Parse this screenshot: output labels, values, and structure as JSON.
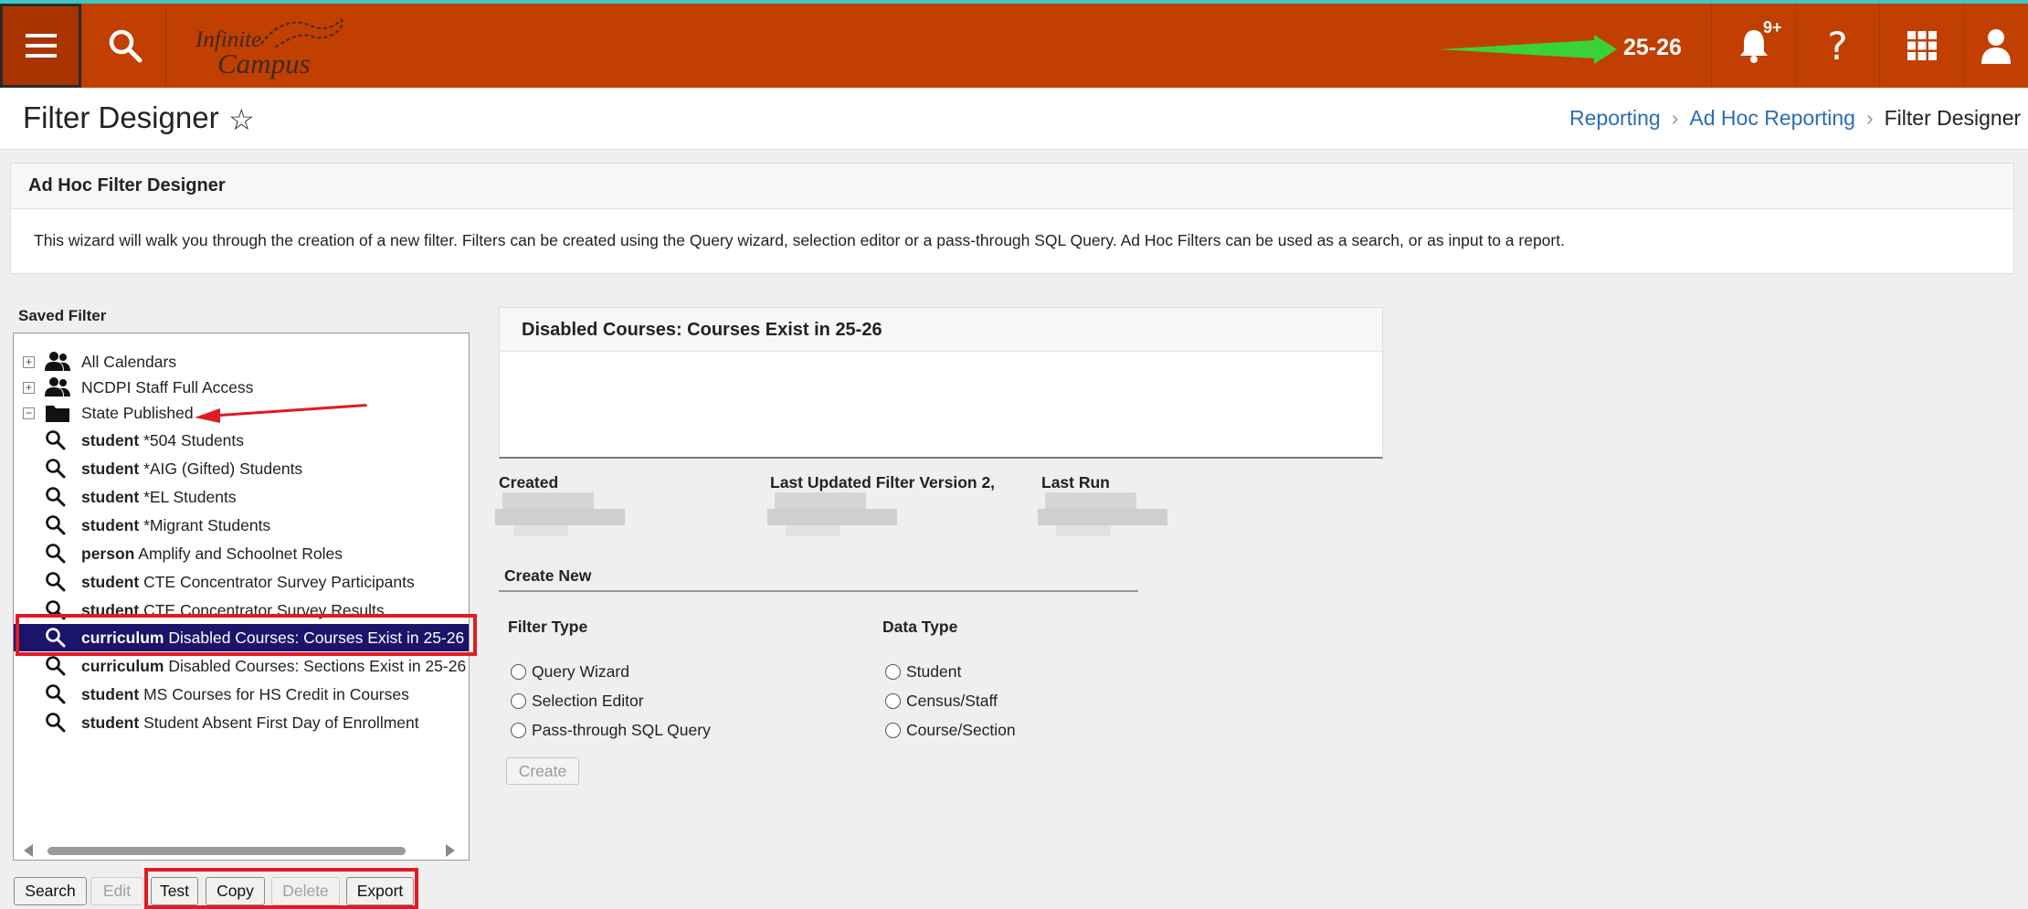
{
  "header": {
    "logo_line1": "Infinite",
    "logo_line2": "Campus",
    "school_year": "25-26",
    "notification_badge": "9+"
  },
  "title": {
    "page_title": "Filter Designer",
    "breadcrumb": [
      "Reporting",
      "Ad Hoc Reporting",
      "Filter Designer"
    ]
  },
  "info": {
    "title": "Ad Hoc Filter Designer",
    "text": "This wizard will walk you through the creation of a new filter. Filters can be created using the Query wizard, selection editor or a pass-through SQL Query. Ad Hoc Filters can be used as a search, or as input to a report."
  },
  "saved_filter": {
    "label": "Saved Filter",
    "folders": [
      {
        "label": "All Calendars",
        "expander": "+"
      },
      {
        "label": "NCDPI Staff Full Access",
        "expander": "+"
      },
      {
        "label": "State Published",
        "expander": "−"
      }
    ],
    "items": [
      {
        "type": "student",
        "name": "*504 Students"
      },
      {
        "type": "student",
        "name": "*AIG (Gifted) Students"
      },
      {
        "type": "student",
        "name": "*EL Students"
      },
      {
        "type": "student",
        "name": "*Migrant Students"
      },
      {
        "type": "person",
        "name": "Amplify and Schoolnet Roles"
      },
      {
        "type": "student",
        "name": "CTE Concentrator Survey Participants"
      },
      {
        "type": "student",
        "name": "CTE Concentrator Survey Results"
      },
      {
        "type": "curriculum",
        "name": "Disabled Courses: Courses Exist in 25-26"
      },
      {
        "type": "curriculum",
        "name": "Disabled Courses: Sections Exist in 25-26"
      },
      {
        "type": "student",
        "name": "MS Courses for HS Credit in Courses"
      },
      {
        "type": "student",
        "name": "Student Absent First Day of Enrollment"
      }
    ],
    "buttons": {
      "search": "Search",
      "edit": "Edit",
      "test": "Test",
      "copy": "Copy",
      "delete": "Delete",
      "export": "Export"
    }
  },
  "detail": {
    "title": "Disabled Courses: Courses Exist in 25-26",
    "created_label": "Created",
    "updated_label": "Last Updated Filter Version 2,",
    "last_run_label": "Last Run"
  },
  "create_new": {
    "title": "Create New",
    "filter_type_label": "Filter Type",
    "filter_types": [
      "Query Wizard",
      "Selection Editor",
      "Pass-through SQL Query"
    ],
    "data_type_label": "Data Type",
    "data_types": [
      "Student",
      "Census/Staff",
      "Course/Section"
    ],
    "create_button": "Create"
  },
  "colors": {
    "topbar": "#c13f00",
    "selected_row": "#1b146b",
    "link": "#2c6db5",
    "annotation_red": "#e01b24",
    "annotation_green": "#3bd13b"
  }
}
